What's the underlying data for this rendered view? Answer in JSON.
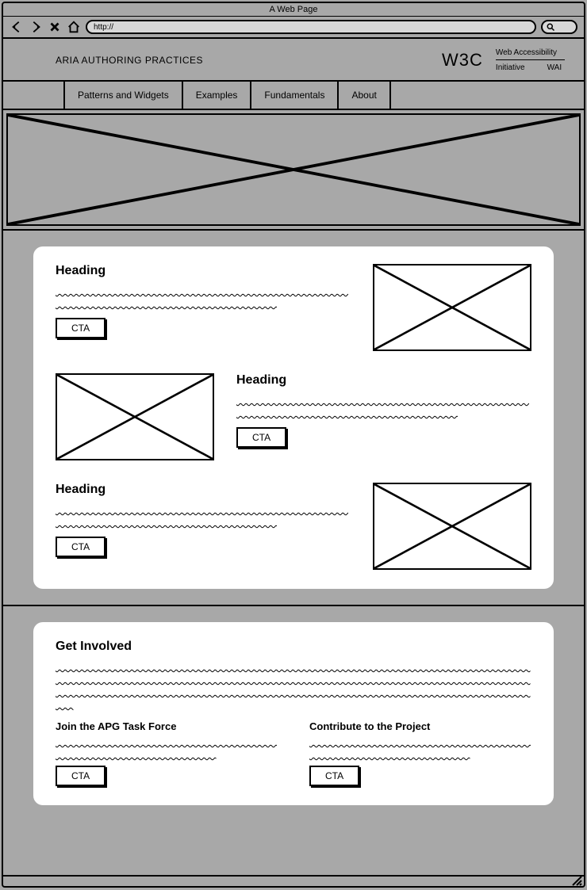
{
  "browser": {
    "title": "A Web Page",
    "url": "http://"
  },
  "header": {
    "site_title": "ARIA AUTHORING PRACTICES",
    "w3c_logo": "W3C",
    "w3c_meta_line1": "Web Accessibility",
    "w3c_meta_line2a": "Initiative",
    "w3c_meta_line2b": "WAI"
  },
  "nav": {
    "items": [
      "Patterns and Widgets",
      "Examples",
      "Fundamentals",
      "About"
    ]
  },
  "features": [
    {
      "heading": "Heading",
      "cta": "CTA"
    },
    {
      "heading": "Heading",
      "cta": "CTA"
    },
    {
      "heading": "Heading",
      "cta": "CTA"
    }
  ],
  "involved": {
    "heading": "Get Involved",
    "col1": {
      "heading": "Join the APG Task Force",
      "cta": "CTA"
    },
    "col2": {
      "heading": "Contribute to the Project",
      "cta": "CTA"
    }
  }
}
